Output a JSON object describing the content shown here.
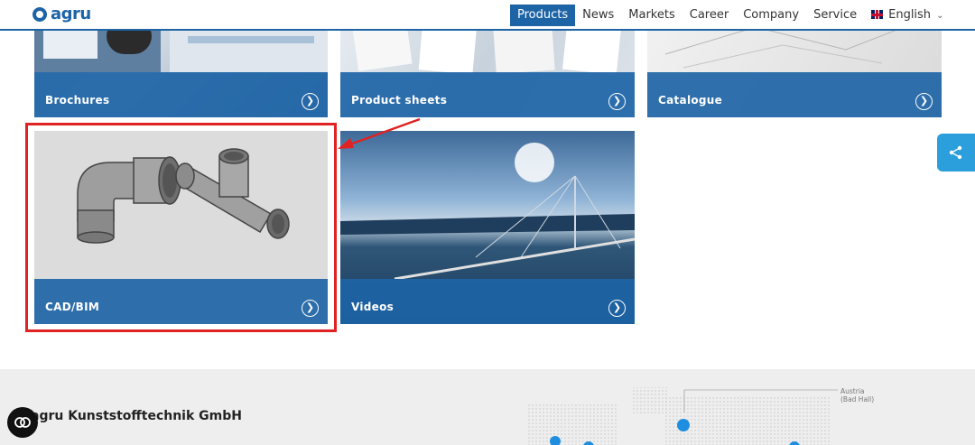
{
  "brand": {
    "logo_text": "agru",
    "accent": "#1d64a6"
  },
  "nav": {
    "items": [
      {
        "label": "Products",
        "active": true
      },
      {
        "label": "News"
      },
      {
        "label": "Markets"
      },
      {
        "label": "Career"
      },
      {
        "label": "Company"
      },
      {
        "label": "Service"
      }
    ],
    "language": "English"
  },
  "tiles": [
    {
      "label": "Brochures"
    },
    {
      "label": "Product sheets"
    },
    {
      "label": "Catalogue"
    },
    {
      "label": "CAD/BIM"
    },
    {
      "label": "Videos"
    }
  ],
  "footer": {
    "company_name": "agru Kunststofftechnik GmbH",
    "map_label_line1": "Austria",
    "map_label_line2": "(Bad Hall)"
  },
  "icons": {
    "arrow": "chevron-right-circle-icon",
    "share": "share-icon",
    "chat": "chat-icon"
  },
  "colors": {
    "highlight": "#e02222",
    "share": "#2a9fdb",
    "footer_bg": "#eeeeee"
  }
}
